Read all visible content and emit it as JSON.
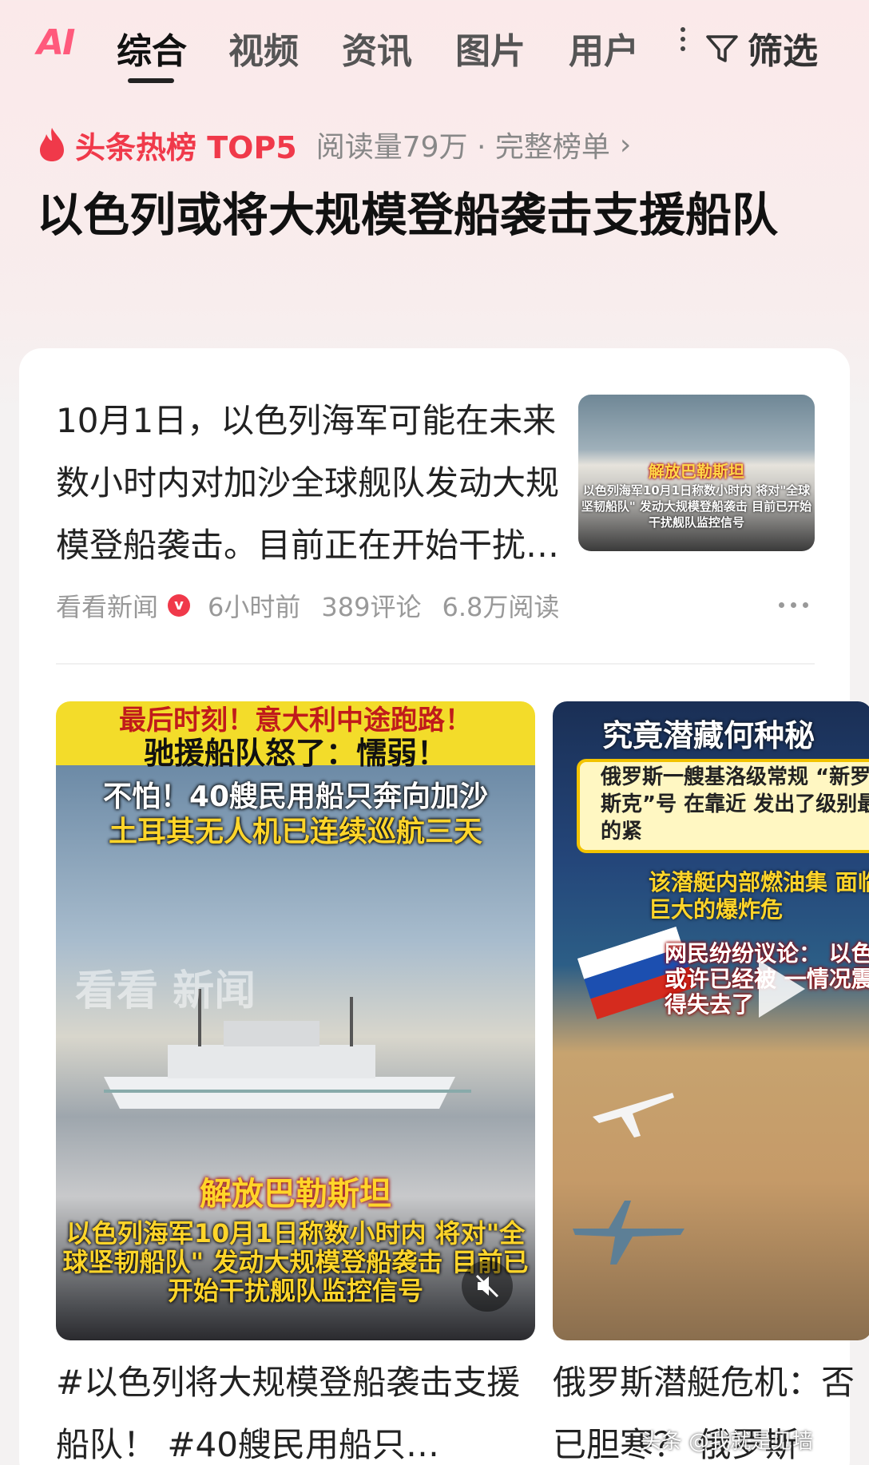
{
  "tabs": {
    "ai_label": "AI",
    "items": [
      "综合",
      "视频",
      "资讯",
      "图片",
      "用户"
    ],
    "active_index": 0,
    "filter_label": "筛选"
  },
  "hot": {
    "label": "头条热榜 TOP5",
    "meta": "阅读量79万 · 完整榜单",
    "chevron": "›",
    "headline": "以色列或将大规模登船袭击支援船队"
  },
  "article": {
    "text": "10月1日，以色列海军可能在未来数小时内对加沙全球舰队发动大规模登船袭击。目前正在开始干扰舰队监控信号",
    "thumb_caption_title": "解放巴勒斯坦",
    "thumb_caption_body": "以色列海军10月1日称数小时内 将对\"全球坚韧船队\" 发动大规模登船袭击 目前已开始干扰舰队监控信号",
    "source": "看看新闻",
    "verified_badge": "v",
    "time": "6小时前",
    "comments": "389评论",
    "reads": "6.8万阅读"
  },
  "video1": {
    "line1": "最后时刻！意大利中途跑路！",
    "line2": "驰援船队怒了：懦弱！",
    "line3": "不怕！40艘民用船只奔向加沙",
    "line4": "土耳其无人机已连续巡航三天",
    "watermark": "看看 新闻",
    "title_red": "解放巴勒斯坦",
    "body": "以色列海军10月1日称数小时内 将对\"全球坚韧船队\" 发动大规模登船袭击 目前已开始干扰舰队监控信号",
    "caption": "#以色列将大规模登船袭击支援船队！ #40艘民用船只…"
  },
  "video2": {
    "line1": "究竟潜藏何种秘",
    "line2": "俄罗斯一艘基洛级常规 “新罗西斯克”号 在靠近 发出了级别最高的紧",
    "line3": "该潜艇内部燃油集 面临着巨大的爆炸危",
    "line4": "网民纷纷议论： 以色列或许已经被 一情况震慑得失去了",
    "caption": "俄罗斯潜艇危机：否已胆寒？ 俄罗斯"
  },
  "footer_watermark": "头条 @我就是见墙",
  "colors": {
    "accent_red": "#f0394a",
    "ai_pink": "#ff5a7c",
    "caption_yellow": "#ffd52a"
  }
}
